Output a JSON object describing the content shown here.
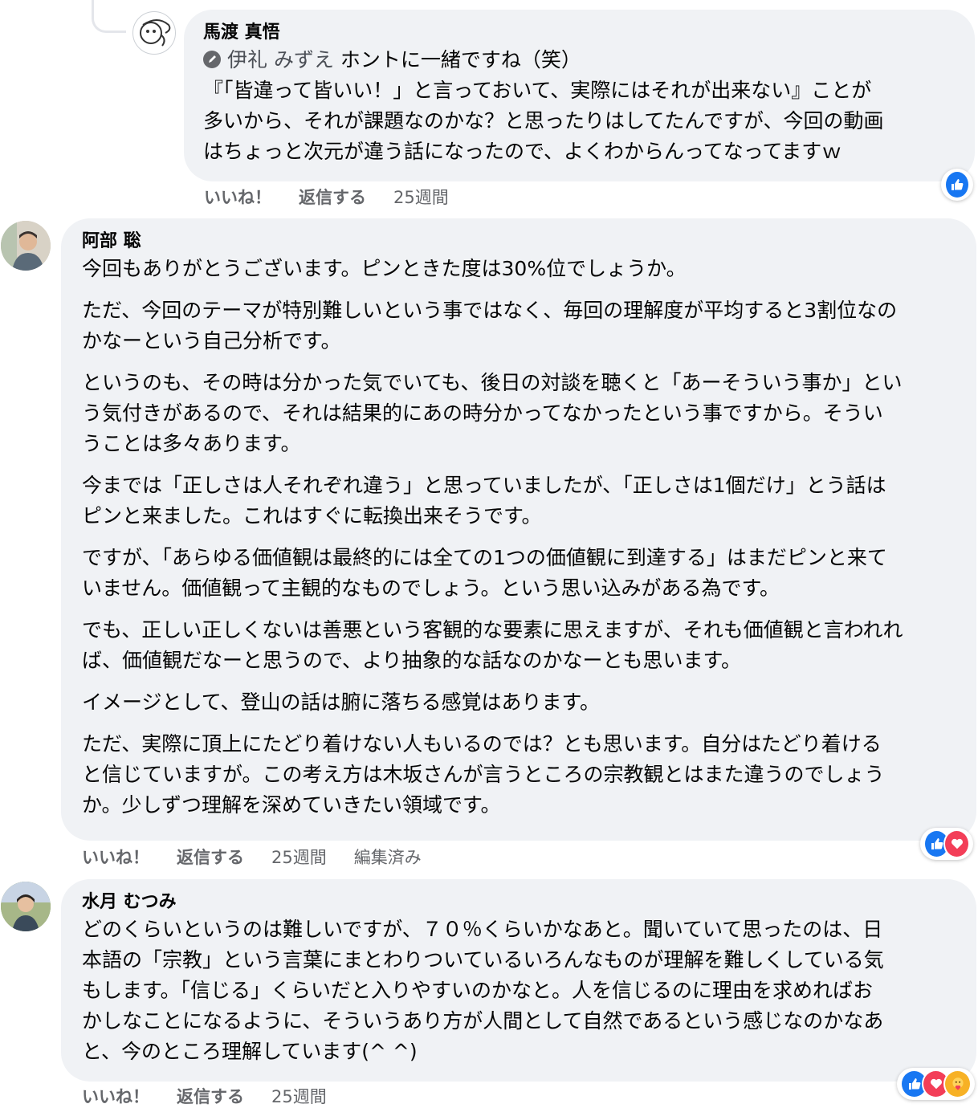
{
  "comments": [
    {
      "author": "馬渡 真悟",
      "mention": "伊礼 みずえ",
      "mention_tail": " ホントに一緒ですね（笑）",
      "lines": [
        "『「皆違って皆いい！」と言っておいて、実際にはそれが出来ない』ことが",
        "多いから、それが課題なのかな？と思ったりはしてたんですが、今回の動画",
        "はちょっと次元が違う話になったので、よくわからんってなってますｗ"
      ],
      "actions": {
        "like": "いいね！",
        "reply": "返信する",
        "time": "25週間"
      },
      "reactions": [
        "like-icon"
      ]
    },
    {
      "author": "阿部 聡",
      "paragraphs": [
        [
          "今回もありがとうございます。ピンときた度は30%位でしょうか。"
        ],
        [
          "ただ、今回のテーマが特別難しいという事ではなく、毎回の理解度が平均すると3割位なの",
          "かなーという自己分析です。"
        ],
        [
          "というのも、その時は分かった気でいても、後日の対談を聴くと「あーそういう事か」とい",
          "う気付きがあるので、それは結果的にあの時分かってなかったという事ですから。そうい",
          "うことは多々あります。"
        ],
        [
          "今までは「正しさは人それぞれ違う」と思っていましたが、「正しさは1個だけ」とう話は",
          "ピンと来ました。これはすぐに転換出来そうです。"
        ],
        [
          "ですが、「あらゆる価値観は最終的には全ての1つの価値観に到達する」はまだピンと来て",
          "いません。価値観って主観的なものでしょう。という思い込みがある為です。"
        ],
        [
          "でも、正しい正しくないは善悪という客観的な要素に思えますが、それも価値観と言われれ",
          "ば、価値観だなーと思うので、より抽象的な話なのかなーとも思います。"
        ],
        [
          "イメージとして、登山の話は腑に落ちる感覚はあります。"
        ],
        [
          "ただ、実際に頂上にたどり着けない人もいるのでは？とも思います。自分はたどり着ける",
          "と信じていますが。この考え方は木坂さんが言うところの宗教観とはまた違うのでしょう",
          "か。少しずつ理解を深めていきたい領域です。"
        ]
      ],
      "actions": {
        "like": "いいね！",
        "reply": "返信する",
        "time": "25週間",
        "edited": "編集済み"
      },
      "reactions": [
        "like-icon",
        "love-icon"
      ]
    },
    {
      "author": "水月 むつみ",
      "lines": [
        "どのくらいというのは難しいですが、７０％くらいかなあと。聞いていて思ったのは、日",
        "本語の「宗教」という言葉にまとわりついているいろんなものが理解を難しくしている気",
        "もします。「信じる」くらいだと入りやすいのかなと。人を信じるのに理由を求めればお",
        "かしなことになるように、そういうあり方が人間として自然であるという感じなのかなあ",
        "と、今のところ理解しています(^ ^)"
      ],
      "actions": {
        "like": "いいね！",
        "reply": "返信する",
        "time": "25週間"
      },
      "reactions": [
        "like-icon",
        "love-icon",
        "care-icon"
      ]
    }
  ]
}
